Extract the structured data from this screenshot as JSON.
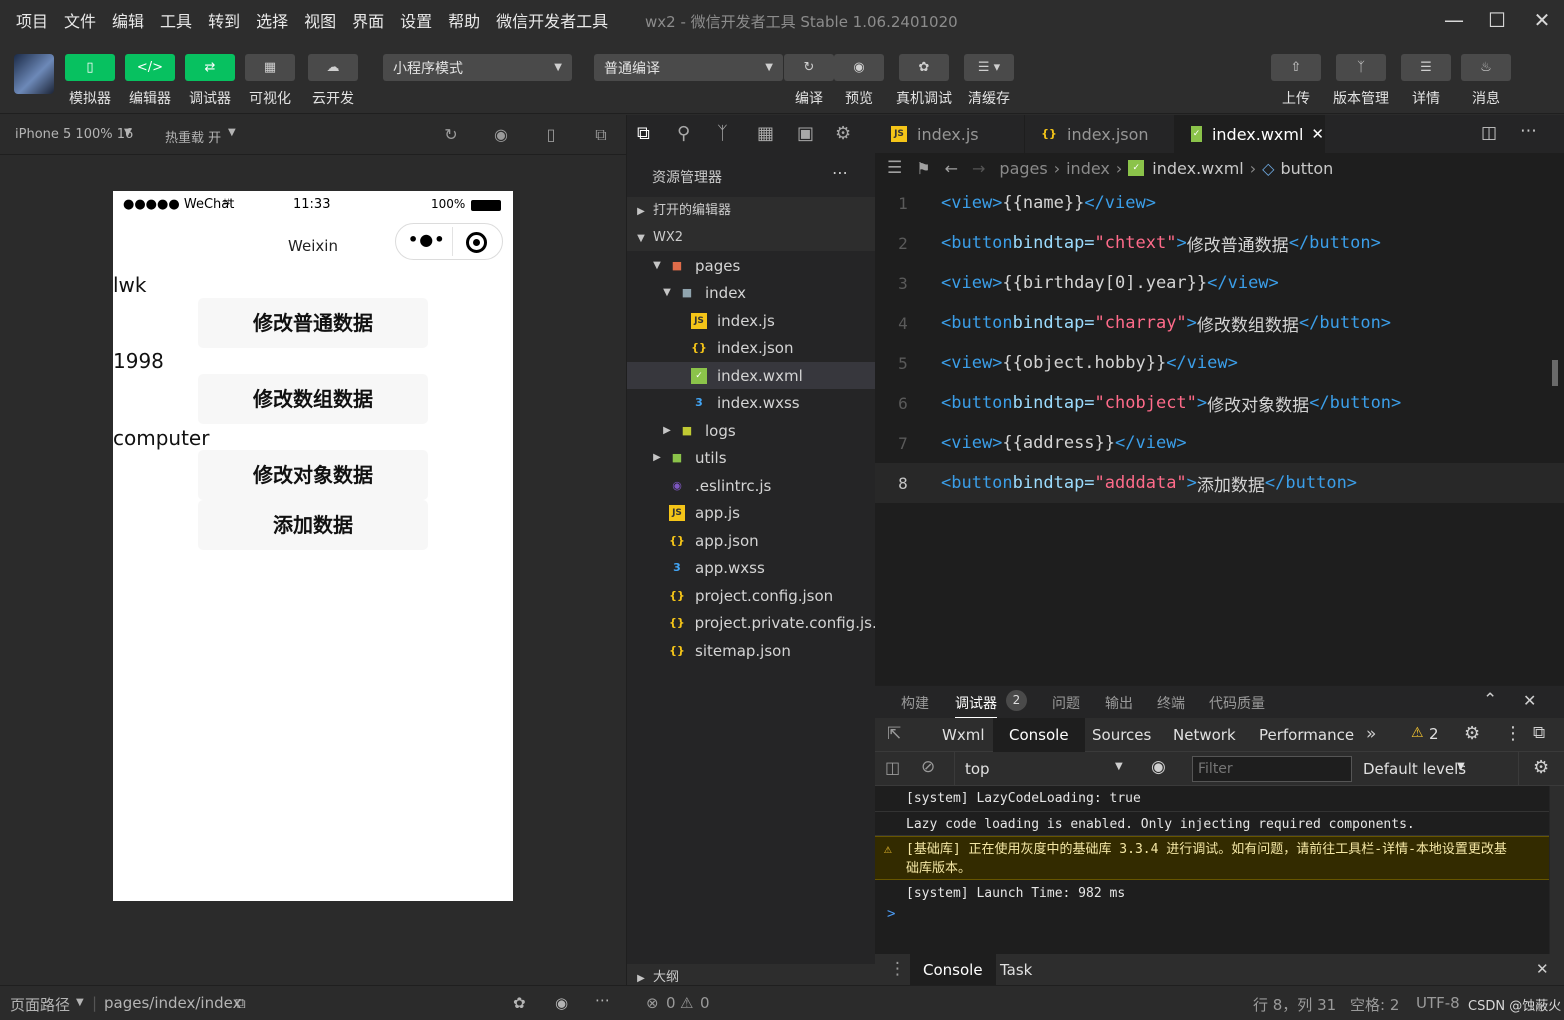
{
  "menubar": {
    "items": [
      "项目",
      "文件",
      "编辑",
      "工具",
      "转到",
      "选择",
      "视图",
      "界面",
      "设置",
      "帮助",
      "微信开发者工具"
    ],
    "window_title": "wx2 - 微信开发者工具 Stable 1.06.2401020"
  },
  "toolbar": {
    "simulator": "模拟器",
    "editor": "编辑器",
    "debugger": "调试器",
    "visual": "可视化",
    "cloud": "云开发",
    "mode_select": "小程序模式",
    "compile_select": "普通编译",
    "compile": "编译",
    "preview": "预览",
    "real_debug": "真机调试",
    "clear_cache": "清缓存",
    "upload": "上传",
    "version": "版本管理",
    "details": "详情",
    "messages": "消息"
  },
  "simulator": {
    "device": "iPhone 5 100% 16",
    "hot_reload": "热重载 开",
    "status_signal": "●●●●● WeChat",
    "status_time": "11:33",
    "status_battery": "100%",
    "nav_title": "Weixin",
    "name": "lwk",
    "btn1": "修改普通数据",
    "year": "1998",
    "btn2": "修改数组数据",
    "hobby": "computer",
    "btn3": "修改对象数据",
    "btn4": "添加数据",
    "page_path_label": "页面路径",
    "page_path": "pages/index/index"
  },
  "explorer": {
    "title": "资源管理器",
    "open_editors": "打开的编辑器",
    "project": "WX2",
    "outline": "大纲",
    "files": [
      {
        "name": "pages",
        "type": "folder-red"
      },
      {
        "name": "index",
        "type": "folder"
      },
      {
        "name": "index.js",
        "type": "js"
      },
      {
        "name": "index.json",
        "type": "json"
      },
      {
        "name": "index.wxml",
        "type": "wxml"
      },
      {
        "name": "index.wxss",
        "type": "wxss"
      },
      {
        "name": "logs",
        "type": "folder-yellow"
      },
      {
        "name": "utils",
        "type": "folder-green"
      },
      {
        "name": ".eslintrc.js",
        "type": "eslint"
      },
      {
        "name": "app.js",
        "type": "js"
      },
      {
        "name": "app.json",
        "type": "json"
      },
      {
        "name": "app.wxss",
        "type": "wxss"
      },
      {
        "name": "project.config.json",
        "type": "json"
      },
      {
        "name": "project.private.config.js...",
        "type": "json"
      },
      {
        "name": "sitemap.json",
        "type": "json"
      }
    ],
    "errors": "0",
    "warnings": "0"
  },
  "editor": {
    "tabs": [
      "index.js",
      "index.json",
      "index.wxml"
    ],
    "breadcrumb": [
      "pages",
      "index",
      "index.wxml",
      "button"
    ],
    "lines": [
      {
        "n": "1",
        "pre": "<view>",
        "attr": "",
        "str": "",
        "mid": "{{name}}",
        "post": "</view>"
      },
      {
        "n": "2",
        "pre": "<button ",
        "attr": "bindtap=",
        "str": "\"chtext\"",
        "mid": "修改普通数据",
        "post": "</button>"
      },
      {
        "n": "3",
        "pre": "<view>",
        "attr": "",
        "str": "",
        "mid": "{{birthday[0].year}}",
        "post": "</view>"
      },
      {
        "n": "4",
        "pre": "<button ",
        "attr": "bindtap=",
        "str": "\"charray\"",
        "mid": "修改数组数据",
        "post": "</button>"
      },
      {
        "n": "5",
        "pre": "<view>",
        "attr": "",
        "str": "",
        "mid": "{{object.hobby}}",
        "post": "</view>"
      },
      {
        "n": "6",
        "pre": "<button ",
        "attr": "bindtap=",
        "str": "\"chobject\"",
        "mid": "修改对象数据",
        "post": "</button>"
      },
      {
        "n": "7",
        "pre": "<view>",
        "attr": "",
        "str": "",
        "mid": "{{address}}",
        "post": "</view>"
      },
      {
        "n": "8",
        "pre": "<button ",
        "attr": "bindtap=",
        "str": "\"adddata\"",
        "mid": "添加数据",
        "post": "</button>"
      }
    ]
  },
  "debug": {
    "tabs": [
      "构建",
      "调试器",
      "问题",
      "输出",
      "终端",
      "代码质量"
    ],
    "debugger_badge": "2",
    "devtools_tabs": [
      "Wxml",
      "Console",
      "Sources",
      "Network",
      "Performance"
    ],
    "warn_count": "2",
    "context": "top",
    "filter_placeholder": "Filter",
    "levels": "Default levels",
    "messages": [
      "[system] LazyCodeLoading: true",
      "Lazy code loading is enabled. Only injecting required components.",
      "[基础库] 正在使用灰度中的基础库 3.3.4 进行调试。如有问题，请前往工具栏-详情-本地设置更改基础库版本。",
      "[system] Launch Time: 982 ms"
    ],
    "prompt": ">",
    "drawer_console": "Console",
    "drawer_task": "Task"
  },
  "statusbar": {
    "position": "行 8，列 31",
    "spaces": "空格: 2",
    "encoding": "UTF-8",
    "watermark": "CSDN @蚀蔽火"
  }
}
